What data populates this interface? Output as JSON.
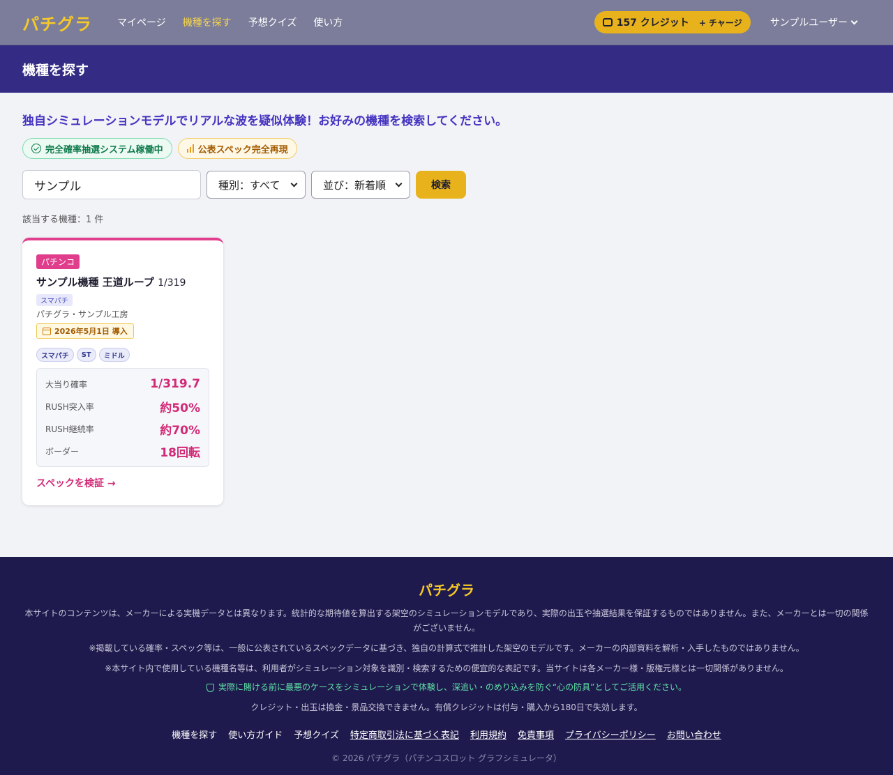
{
  "nav": {
    "logo": "パチグラ",
    "links": [
      "マイページ",
      "機種を探す",
      "予想クイズ",
      "使い方"
    ],
    "credits": "157 クレジット",
    "charge": "+ チャージ",
    "user": "サンプルユーザー"
  },
  "page": {
    "title": "機種を探す",
    "intro": "独自シミュレーションモデルでリアルな波を疑似体験！お好みの機種を検索してください。",
    "badge_1": "完全確率抽選システム稼働中",
    "badge_2": "公表スペック完全再現",
    "search_value": "サンプル",
    "filter_type": "種別：すべて",
    "filter_sort": "並び：新着順",
    "search_button": "検索",
    "result_count": "該当する機種：1 件"
  },
  "card": {
    "type": "パチンコ",
    "name": "サンプル機種 王道ループ",
    "prob": "1/319",
    "subtype": "スマパチ",
    "maker": "パチグラ・サンプル工房",
    "date": "2026年5月1日 導入",
    "chips": [
      "スマパチ",
      "ST",
      "ミドル"
    ],
    "specs": [
      {
        "label": "大当り確率",
        "value": "1/319.7"
      },
      {
        "label": "RUSH突入率",
        "value": "約50%"
      },
      {
        "label": "RUSH継続率",
        "value": "約70%"
      },
      {
        "label": "ボーダー",
        "value": "18回転"
      }
    ],
    "verify": "スペックを検証 →"
  },
  "footer": {
    "logo": "パチグラ",
    "note_1": "本サイトのコンテンツは、メーカーによる実機データとは異なります。統計的な期待値を算出する架空のシミュレーションモデルであり、実際の出玉や抽選結果を保証するものではありません。また、メーカーとは一切の関係がございません。",
    "note_2": "※掲載している確率・スペック等は、一般に公表されているスペックデータに基づき、独自の計算式で推計した架空のモデルです。メーカーの内部資料を解析・入手したものではありません。",
    "note_3": "※本サイト内で使用している機種名等は、利用者がシミュレーション対象を識別・検索するための便宜的な表記です。当サイトは各メーカー様・版権元様とは一切関係がありません。",
    "note_4": "実際に賭ける前に最悪のケースをシミュレーションで体験し、深追い・のめり込みを防ぐ“心の防具”としてご活用ください。",
    "note_5": "クレジット・出玉は換金・景品交換できません。有償クレジットは付与・購入から180日で失効します。",
    "links": [
      "機種を探す",
      "使い方ガイド",
      "予想クイズ",
      "特定商取引法に基づく表記",
      "利用規約",
      "免責事項",
      "プライバシーポリシー",
      "お問い合わせ"
    ],
    "copyright": "© 2026 パチグラ（パチンコスロット グラフシミュレータ）"
  }
}
